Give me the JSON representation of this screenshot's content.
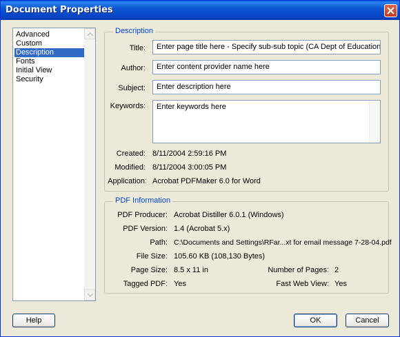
{
  "window": {
    "title": "Document Properties"
  },
  "sidebar": {
    "items": [
      {
        "label": "Advanced",
        "selected": false
      },
      {
        "label": "Custom",
        "selected": false
      },
      {
        "label": "Description",
        "selected": true
      },
      {
        "label": "Fonts",
        "selected": false
      },
      {
        "label": "Initial View",
        "selected": false
      },
      {
        "label": "Security",
        "selected": false
      }
    ]
  },
  "description": {
    "heading": "Description",
    "title_label": "Title:",
    "title_value": "Enter page title here - Specify sub-sub topic (CA Dept of Education)",
    "author_label": "Author:",
    "author_value": "Enter content provider name here",
    "subject_label": "Subject:",
    "subject_value": "Enter description here",
    "keywords_label": "Keywords:",
    "keywords_value": "Enter keywords here",
    "created_label": "Created:",
    "created_value": "8/11/2004 2:59:16 PM",
    "modified_label": "Modified:",
    "modified_value": "8/11/2004 3:00:05 PM",
    "application_label": "Application:",
    "application_value": "Acrobat PDFMaker 6.0 for Word"
  },
  "pdf_info": {
    "heading": "PDF Information",
    "producer_label": "PDF Producer:",
    "producer_value": "Acrobat Distiller 6.0.1 (Windows)",
    "version_label": "PDF Version:",
    "version_value": "1.4 (Acrobat 5.x)",
    "path_label": "Path:",
    "path_value": "C:\\Documents and Settings\\RFar...xt for email message 7-28-04.pdf",
    "filesize_label": "File Size:",
    "filesize_value": "105.60 KB (108,130 Bytes)",
    "pagesize_label": "Page Size:",
    "pagesize_value": "8.5 x 11 in",
    "numpages_label": "Number of Pages:",
    "numpages_value": "2",
    "tagged_label": "Tagged PDF:",
    "tagged_value": "Yes",
    "fastweb_label": "Fast Web View:",
    "fastweb_value": "Yes"
  },
  "buttons": {
    "help": "Help",
    "ok": "OK",
    "cancel": "Cancel"
  },
  "colors": {
    "title_bar": "#0542c6",
    "selection": "#316ac5",
    "group_heading": "#0046d5",
    "dialog_bg": "#ece9d8"
  }
}
